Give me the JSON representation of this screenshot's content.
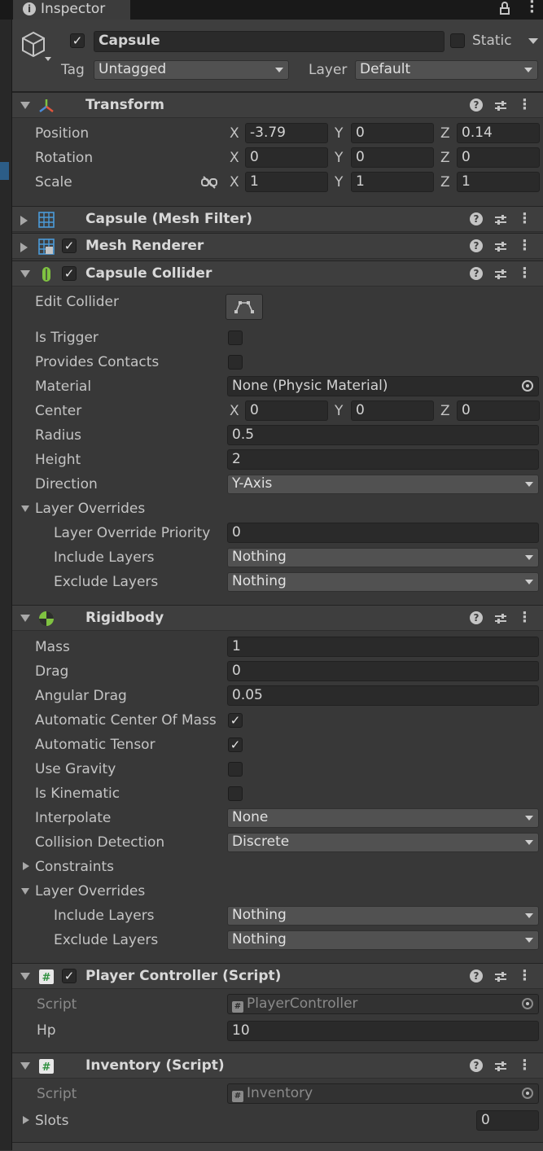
{
  "tab": {
    "title": "Inspector"
  },
  "object": {
    "name": "Capsule",
    "static_label": "Static",
    "tag_label": "Tag",
    "tag_value": "Untagged",
    "layer_label": "Layer",
    "layer_value": "Default"
  },
  "transform": {
    "title": "Transform",
    "position_label": "Position",
    "position": {
      "x": "-3.79",
      "y": "0",
      "z": "0.14"
    },
    "rotation_label": "Rotation",
    "rotation": {
      "x": "0",
      "y": "0",
      "z": "0"
    },
    "scale_label": "Scale",
    "scale": {
      "x": "1",
      "y": "1",
      "z": "1"
    }
  },
  "axes": {
    "x": "X",
    "y": "Y",
    "z": "Z"
  },
  "mesh_filter": {
    "title": "Capsule (Mesh Filter)"
  },
  "mesh_renderer": {
    "title": "Mesh Renderer"
  },
  "capsule_collider": {
    "title": "Capsule Collider",
    "edit_collider": "Edit Collider",
    "is_trigger": "Is Trigger",
    "provides_contacts": "Provides Contacts",
    "material_label": "Material",
    "material_value": "None (Physic Material)",
    "center_label": "Center",
    "center": {
      "x": "0",
      "y": "0",
      "z": "0"
    },
    "radius_label": "Radius",
    "radius": "0.5",
    "height_label": "Height",
    "height": "2",
    "direction_label": "Direction",
    "direction": "Y-Axis",
    "layer_overrides": "Layer Overrides",
    "priority_label": "Layer Override Priority",
    "priority": "0",
    "include_label": "Include Layers",
    "include": "Nothing",
    "exclude_label": "Exclude Layers",
    "exclude": "Nothing"
  },
  "rigidbody": {
    "title": "Rigidbody",
    "mass_label": "Mass",
    "mass": "1",
    "drag_label": "Drag",
    "drag": "0",
    "angular_drag_label": "Angular Drag",
    "angular_drag": "0.05",
    "auto_com_label": "Automatic Center Of Mass",
    "auto_tensor_label": "Automatic Tensor",
    "use_gravity_label": "Use Gravity",
    "is_kinematic_label": "Is Kinematic",
    "interpolate_label": "Interpolate",
    "interpolate": "None",
    "collision_label": "Collision Detection",
    "collision": "Discrete",
    "constraints": "Constraints",
    "layer_overrides": "Layer Overrides",
    "include_label": "Include Layers",
    "include": "Nothing",
    "exclude_label": "Exclude Layers",
    "exclude": "Nothing"
  },
  "player_controller": {
    "title": "Player Controller (Script)",
    "script_label": "Script",
    "script": "PlayerController",
    "hp_label": "Hp",
    "hp": "10"
  },
  "inventory": {
    "title": "Inventory (Script)",
    "script_label": "Script",
    "script": "Inventory",
    "slots_label": "Slots",
    "slots": "0"
  },
  "colors": {
    "accent_selected": "#2c5d87",
    "bg": "#383838",
    "header": "#3e3e3e"
  }
}
